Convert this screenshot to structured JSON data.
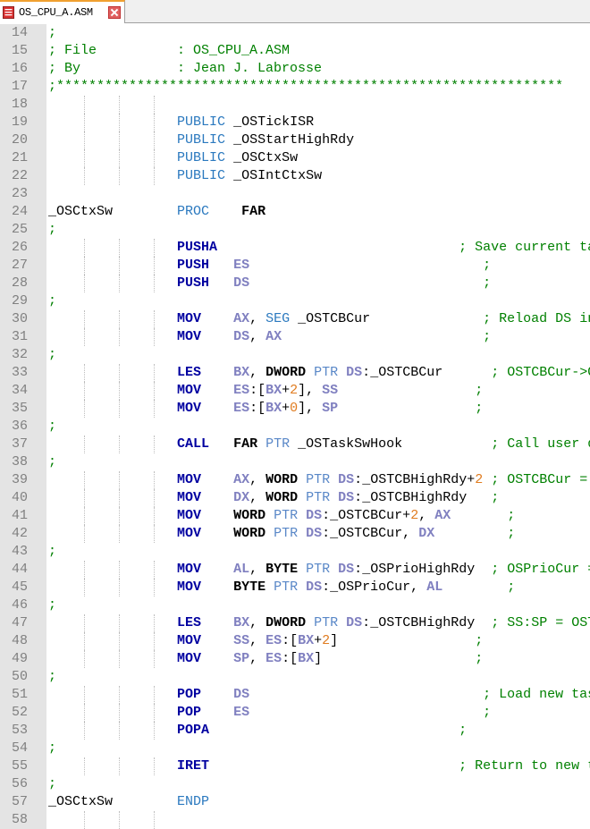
{
  "tab": {
    "label": "OS_CPU_A.ASM",
    "file_icon": "file-icon",
    "close_icon": "close-icon"
  },
  "colors": {
    "comment": "#008000",
    "instruction": "#0000a0",
    "register": "#8080c0",
    "directive": "#2b79bf",
    "number": "#e07c20",
    "gutter": "#e4e4e4"
  },
  "lines": [
    {
      "n": "14",
      "guides": 0,
      "tokens": [
        [
          "cm",
          ";"
        ]
      ]
    },
    {
      "n": "15",
      "guides": 0,
      "tokens": [
        [
          "cm",
          "; File          : OS_CPU_A.ASM"
        ]
      ]
    },
    {
      "n": "16",
      "guides": 0,
      "tokens": [
        [
          "cm",
          "; By            : Jean J. Labrosse"
        ]
      ]
    },
    {
      "n": "17",
      "guides": 0,
      "tokens": [
        [
          "cm",
          ";***************************************************************"
        ]
      ]
    },
    {
      "n": "18",
      "guides": 3,
      "tokens": []
    },
    {
      "n": "19",
      "guides": 3,
      "tokens": [
        [
          "sp",
          "                "
        ],
        [
          "dir",
          "PUBLIC"
        ],
        [
          "sp",
          " "
        ],
        [
          "id",
          "_OSTickISR"
        ]
      ]
    },
    {
      "n": "20",
      "guides": 3,
      "tokens": [
        [
          "sp",
          "                "
        ],
        [
          "dir",
          "PUBLIC"
        ],
        [
          "sp",
          " "
        ],
        [
          "id",
          "_OSStartHighRdy"
        ]
      ]
    },
    {
      "n": "21",
      "guides": 3,
      "tokens": [
        [
          "sp",
          "                "
        ],
        [
          "dir",
          "PUBLIC"
        ],
        [
          "sp",
          " "
        ],
        [
          "id",
          "_OSCtxSw"
        ]
      ]
    },
    {
      "n": "22",
      "guides": 3,
      "tokens": [
        [
          "sp",
          "                "
        ],
        [
          "dir",
          "PUBLIC"
        ],
        [
          "sp",
          " "
        ],
        [
          "id",
          "_OSIntCtxSw"
        ]
      ]
    },
    {
      "n": "23",
      "guides": 0,
      "tokens": []
    },
    {
      "n": "24",
      "guides": 0,
      "tokens": [
        [
          "id",
          "_OSCtxSw"
        ],
        [
          "sp",
          "        "
        ],
        [
          "dir",
          "PROC"
        ],
        [
          "sp",
          "    "
        ],
        [
          "sz",
          "FAR"
        ]
      ]
    },
    {
      "n": "25",
      "guides": 0,
      "tokens": [
        [
          "cm",
          ";"
        ]
      ]
    },
    {
      "n": "26",
      "guides": 3,
      "tokens": [
        [
          "sp",
          "                "
        ],
        [
          "kw",
          "PUSHA"
        ],
        [
          "sp",
          "                              "
        ],
        [
          "cm",
          "; Save current task's context"
        ]
      ]
    },
    {
      "n": "27",
      "guides": 3,
      "tokens": [
        [
          "sp",
          "                "
        ],
        [
          "kw",
          "PUSH"
        ],
        [
          "sp",
          "   "
        ],
        [
          "rg",
          "ES"
        ],
        [
          "sp",
          "                             "
        ],
        [
          "cm",
          ";"
        ]
      ]
    },
    {
      "n": "28",
      "guides": 3,
      "tokens": [
        [
          "sp",
          "                "
        ],
        [
          "kw",
          "PUSH"
        ],
        [
          "sp",
          "   "
        ],
        [
          "rg",
          "DS"
        ],
        [
          "sp",
          "                             "
        ],
        [
          "cm",
          ";"
        ]
      ]
    },
    {
      "n": "29",
      "guides": 0,
      "tokens": [
        [
          "cm",
          ";"
        ]
      ]
    },
    {
      "n": "30",
      "guides": 3,
      "tokens": [
        [
          "sp",
          "                "
        ],
        [
          "kw",
          "MOV"
        ],
        [
          "sp",
          "    "
        ],
        [
          "rg",
          "AX"
        ],
        [
          "op",
          ", "
        ],
        [
          "dir",
          "SEG"
        ],
        [
          "sp",
          " "
        ],
        [
          "id",
          "_OSTCBCur"
        ],
        [
          "sp",
          "              "
        ],
        [
          "cm",
          "; Reload DS in case it was altered"
        ]
      ]
    },
    {
      "n": "31",
      "guides": 3,
      "tokens": [
        [
          "sp",
          "                "
        ],
        [
          "kw",
          "MOV"
        ],
        [
          "sp",
          "    "
        ],
        [
          "rg",
          "DS"
        ],
        [
          "op",
          ", "
        ],
        [
          "rg",
          "AX"
        ],
        [
          "sp",
          "                         "
        ],
        [
          "cm",
          ";"
        ]
      ]
    },
    {
      "n": "32",
      "guides": 0,
      "tokens": [
        [
          "cm",
          ";"
        ]
      ]
    },
    {
      "n": "33",
      "guides": 3,
      "tokens": [
        [
          "sp",
          "                "
        ],
        [
          "kw",
          "LES"
        ],
        [
          "sp",
          "    "
        ],
        [
          "rg",
          "BX"
        ],
        [
          "op",
          ", "
        ],
        [
          "sz",
          "DWORD"
        ],
        [
          "sp",
          " "
        ],
        [
          "ptr",
          "PTR"
        ],
        [
          "sp",
          " "
        ],
        [
          "rg",
          "DS"
        ],
        [
          "op",
          ":"
        ],
        [
          "id",
          "_OSTCBCur"
        ],
        [
          "sp",
          "      "
        ],
        [
          "cm",
          "; OSTCBCur->OSTCBStkPtr = SS:SP"
        ]
      ]
    },
    {
      "n": "34",
      "guides": 3,
      "tokens": [
        [
          "sp",
          "                "
        ],
        [
          "kw",
          "MOV"
        ],
        [
          "sp",
          "    "
        ],
        [
          "rg",
          "ES"
        ],
        [
          "op",
          ":["
        ],
        [
          "rg",
          "BX"
        ],
        [
          "op",
          "+"
        ],
        [
          "num",
          "2"
        ],
        [
          "op",
          "], "
        ],
        [
          "rg",
          "SS"
        ],
        [
          "sp",
          "                 "
        ],
        [
          "cm",
          ";"
        ]
      ]
    },
    {
      "n": "35",
      "guides": 3,
      "tokens": [
        [
          "sp",
          "                "
        ],
        [
          "kw",
          "MOV"
        ],
        [
          "sp",
          "    "
        ],
        [
          "rg",
          "ES"
        ],
        [
          "op",
          ":["
        ],
        [
          "rg",
          "BX"
        ],
        [
          "op",
          "+"
        ],
        [
          "num",
          "0"
        ],
        [
          "op",
          "], "
        ],
        [
          "rg",
          "SP"
        ],
        [
          "sp",
          "                 "
        ],
        [
          "cm",
          ";"
        ]
      ]
    },
    {
      "n": "36",
      "guides": 0,
      "tokens": [
        [
          "cm",
          ";"
        ]
      ]
    },
    {
      "n": "37",
      "guides": 3,
      "tokens": [
        [
          "sp",
          "                "
        ],
        [
          "kw",
          "CALL"
        ],
        [
          "sp",
          "   "
        ],
        [
          "sz",
          "FAR"
        ],
        [
          "sp",
          " "
        ],
        [
          "ptr",
          "PTR"
        ],
        [
          "sp",
          " "
        ],
        [
          "id",
          "_OSTaskSwHook"
        ],
        [
          "sp",
          "           "
        ],
        [
          "cm",
          "; Call user defined task switch hook"
        ]
      ]
    },
    {
      "n": "38",
      "guides": 0,
      "tokens": [
        [
          "cm",
          ";"
        ]
      ]
    },
    {
      "n": "39",
      "guides": 3,
      "tokens": [
        [
          "sp",
          "                "
        ],
        [
          "kw",
          "MOV"
        ],
        [
          "sp",
          "    "
        ],
        [
          "rg",
          "AX"
        ],
        [
          "op",
          ", "
        ],
        [
          "sz",
          "WORD"
        ],
        [
          "sp",
          " "
        ],
        [
          "ptr",
          "PTR"
        ],
        [
          "sp",
          " "
        ],
        [
          "rg",
          "DS"
        ],
        [
          "op",
          ":"
        ],
        [
          "id",
          "_OSTCBHighRdy"
        ],
        [
          "op",
          "+"
        ],
        [
          "num",
          "2"
        ],
        [
          "sp",
          " "
        ],
        [
          "cm",
          "; OSTCBCur = OSTCBHighRdy"
        ]
      ]
    },
    {
      "n": "40",
      "guides": 3,
      "tokens": [
        [
          "sp",
          "                "
        ],
        [
          "kw",
          "MOV"
        ],
        [
          "sp",
          "    "
        ],
        [
          "rg",
          "DX"
        ],
        [
          "op",
          ", "
        ],
        [
          "sz",
          "WORD"
        ],
        [
          "sp",
          " "
        ],
        [
          "ptr",
          "PTR"
        ],
        [
          "sp",
          " "
        ],
        [
          "rg",
          "DS"
        ],
        [
          "op",
          ":"
        ],
        [
          "id",
          "_OSTCBHighRdy"
        ],
        [
          "sp",
          "   "
        ],
        [
          "cm",
          ";"
        ]
      ]
    },
    {
      "n": "41",
      "guides": 3,
      "tokens": [
        [
          "sp",
          "                "
        ],
        [
          "kw",
          "MOV"
        ],
        [
          "sp",
          "    "
        ],
        [
          "sz",
          "WORD"
        ],
        [
          "sp",
          " "
        ],
        [
          "ptr",
          "PTR"
        ],
        [
          "sp",
          " "
        ],
        [
          "rg",
          "DS"
        ],
        [
          "op",
          ":"
        ],
        [
          "id",
          "_OSTCBCur"
        ],
        [
          "op",
          "+"
        ],
        [
          "num",
          "2"
        ],
        [
          "op",
          ", "
        ],
        [
          "rg",
          "AX"
        ],
        [
          "sp",
          "       "
        ],
        [
          "cm",
          ";"
        ]
      ]
    },
    {
      "n": "42",
      "guides": 3,
      "tokens": [
        [
          "sp",
          "                "
        ],
        [
          "kw",
          "MOV"
        ],
        [
          "sp",
          "    "
        ],
        [
          "sz",
          "WORD"
        ],
        [
          "sp",
          " "
        ],
        [
          "ptr",
          "PTR"
        ],
        [
          "sp",
          " "
        ],
        [
          "rg",
          "DS"
        ],
        [
          "op",
          ":"
        ],
        [
          "id",
          "_OSTCBCur"
        ],
        [
          "op",
          ", "
        ],
        [
          "rg",
          "DX"
        ],
        [
          "sp",
          "         "
        ],
        [
          "cm",
          ";"
        ]
      ]
    },
    {
      "n": "43",
      "guides": 0,
      "tokens": [
        [
          "cm",
          ";"
        ]
      ]
    },
    {
      "n": "44",
      "guides": 3,
      "tokens": [
        [
          "sp",
          "                "
        ],
        [
          "kw",
          "MOV"
        ],
        [
          "sp",
          "    "
        ],
        [
          "rg",
          "AL"
        ],
        [
          "op",
          ", "
        ],
        [
          "sz",
          "BYTE"
        ],
        [
          "sp",
          " "
        ],
        [
          "ptr",
          "PTR"
        ],
        [
          "sp",
          " "
        ],
        [
          "rg",
          "DS"
        ],
        [
          "op",
          ":"
        ],
        [
          "id",
          "_OSPrioHighRdy"
        ],
        [
          "sp",
          "  "
        ],
        [
          "cm",
          "; OSPrioCur = OSPrioHighRdy"
        ]
      ]
    },
    {
      "n": "45",
      "guides": 3,
      "tokens": [
        [
          "sp",
          "                "
        ],
        [
          "kw",
          "MOV"
        ],
        [
          "sp",
          "    "
        ],
        [
          "sz",
          "BYTE"
        ],
        [
          "sp",
          " "
        ],
        [
          "ptr",
          "PTR"
        ],
        [
          "sp",
          " "
        ],
        [
          "rg",
          "DS"
        ],
        [
          "op",
          ":"
        ],
        [
          "id",
          "_OSPrioCur"
        ],
        [
          "op",
          ", "
        ],
        [
          "rg",
          "AL"
        ],
        [
          "sp",
          "        "
        ],
        [
          "cm",
          ";"
        ]
      ]
    },
    {
      "n": "46",
      "guides": 0,
      "tokens": [
        [
          "cm",
          ";"
        ]
      ]
    },
    {
      "n": "47",
      "guides": 3,
      "tokens": [
        [
          "sp",
          "                "
        ],
        [
          "kw",
          "LES"
        ],
        [
          "sp",
          "    "
        ],
        [
          "rg",
          "BX"
        ],
        [
          "op",
          ", "
        ],
        [
          "sz",
          "DWORD"
        ],
        [
          "sp",
          " "
        ],
        [
          "ptr",
          "PTR"
        ],
        [
          "sp",
          " "
        ],
        [
          "rg",
          "DS"
        ],
        [
          "op",
          ":"
        ],
        [
          "id",
          "_OSTCBHighRdy"
        ],
        [
          "sp",
          "  "
        ],
        [
          "cm",
          "; SS:SP = OSTCBHighRdy->OSTCBStkPtr"
        ]
      ]
    },
    {
      "n": "48",
      "guides": 3,
      "tokens": [
        [
          "sp",
          "                "
        ],
        [
          "kw",
          "MOV"
        ],
        [
          "sp",
          "    "
        ],
        [
          "rg",
          "SS"
        ],
        [
          "op",
          ", "
        ],
        [
          "rg",
          "ES"
        ],
        [
          "op",
          ":["
        ],
        [
          "rg",
          "BX"
        ],
        [
          "op",
          "+"
        ],
        [
          "num",
          "2"
        ],
        [
          "op",
          "]"
        ],
        [
          "sp",
          "                 "
        ],
        [
          "cm",
          ";"
        ]
      ]
    },
    {
      "n": "49",
      "guides": 3,
      "tokens": [
        [
          "sp",
          "                "
        ],
        [
          "kw",
          "MOV"
        ],
        [
          "sp",
          "    "
        ],
        [
          "rg",
          "SP"
        ],
        [
          "op",
          ", "
        ],
        [
          "rg",
          "ES"
        ],
        [
          "op",
          ":["
        ],
        [
          "rg",
          "BX"
        ],
        [
          "op",
          "]"
        ],
        [
          "sp",
          "                   "
        ],
        [
          "cm",
          ";"
        ]
      ]
    },
    {
      "n": "50",
      "guides": 0,
      "tokens": [
        [
          "cm",
          ";"
        ]
      ]
    },
    {
      "n": "51",
      "guides": 3,
      "tokens": [
        [
          "sp",
          "                "
        ],
        [
          "kw",
          "POP"
        ],
        [
          "sp",
          "    "
        ],
        [
          "rg",
          "DS"
        ],
        [
          "sp",
          "                             "
        ],
        [
          "cm",
          "; Load new task's context"
        ]
      ]
    },
    {
      "n": "52",
      "guides": 3,
      "tokens": [
        [
          "sp",
          "                "
        ],
        [
          "kw",
          "POP"
        ],
        [
          "sp",
          "    "
        ],
        [
          "rg",
          "ES"
        ],
        [
          "sp",
          "                             "
        ],
        [
          "cm",
          ";"
        ]
      ]
    },
    {
      "n": "53",
      "guides": 3,
      "tokens": [
        [
          "sp",
          "                "
        ],
        [
          "kw",
          "POPA"
        ],
        [
          "sp",
          "                               "
        ],
        [
          "cm",
          ";"
        ]
      ]
    },
    {
      "n": "54",
      "guides": 0,
      "tokens": [
        [
          "cm",
          ";"
        ]
      ]
    },
    {
      "n": "55",
      "guides": 3,
      "tokens": [
        [
          "sp",
          "                "
        ],
        [
          "kw",
          "IRET"
        ],
        [
          "sp",
          "                               "
        ],
        [
          "cm",
          "; Return to new task"
        ]
      ]
    },
    {
      "n": "56",
      "guides": 0,
      "tokens": [
        [
          "cm",
          ";"
        ]
      ]
    },
    {
      "n": "57",
      "guides": 0,
      "tokens": [
        [
          "id",
          "_OSCtxSw"
        ],
        [
          "sp",
          "        "
        ],
        [
          "dir",
          "ENDP"
        ]
      ]
    },
    {
      "n": "58",
      "guides": 3,
      "tokens": []
    }
  ]
}
